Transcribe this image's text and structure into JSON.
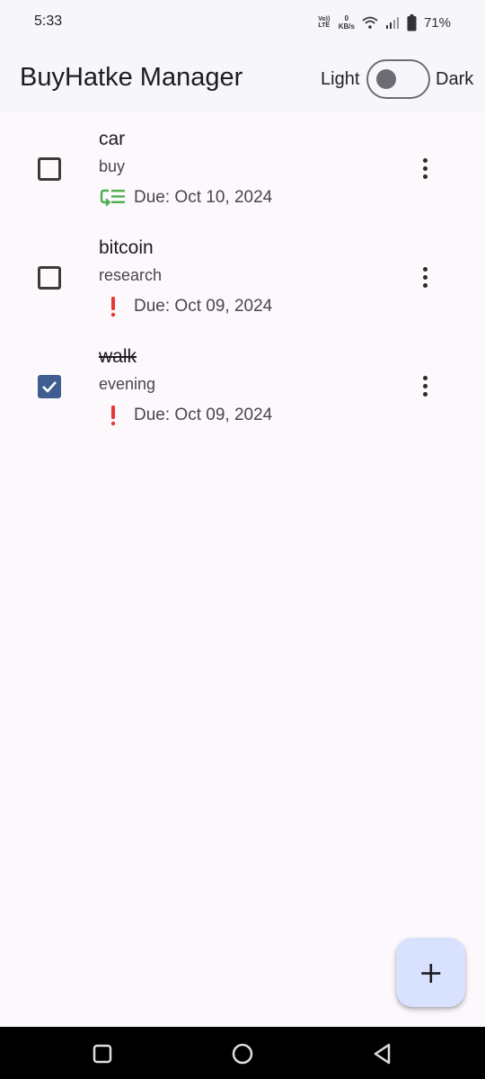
{
  "status_bar": {
    "time": "5:33",
    "volte_line1": "Vo))",
    "volte_line2": "LTE",
    "net_speed_value": "0",
    "net_speed_unit": "KB/s",
    "battery_percent": "71%"
  },
  "app_bar": {
    "title": "BuyHatke Manager",
    "theme_light_label": "Light",
    "theme_dark_label": "Dark",
    "dark_mode_enabled": false
  },
  "tasks": [
    {
      "title": "car",
      "description": "buy",
      "due": "Due: Oct 10, 2024",
      "priority_icon": "low-priority-icon",
      "priority_color": "#4caf50",
      "completed": false
    },
    {
      "title": "bitcoin",
      "description": "research",
      "due": "Due: Oct 09, 2024",
      "priority_icon": "high-priority-icon",
      "priority_color": "#e53935",
      "completed": false
    },
    {
      "title": "walk",
      "description": "evening",
      "due": "Due: Oct 09, 2024",
      "priority_icon": "high-priority-icon",
      "priority_color": "#e53935",
      "completed": true
    }
  ],
  "fab": {
    "icon": "plus-icon"
  },
  "nav_bar": {
    "icons": [
      "recent-apps-icon",
      "home-icon",
      "back-icon"
    ]
  },
  "colors": {
    "accent": "#3f5d8f",
    "fab_background": "#d8e2ff",
    "app_bar_background": "#f7f7fb",
    "page_background": "#fdf8fc"
  }
}
